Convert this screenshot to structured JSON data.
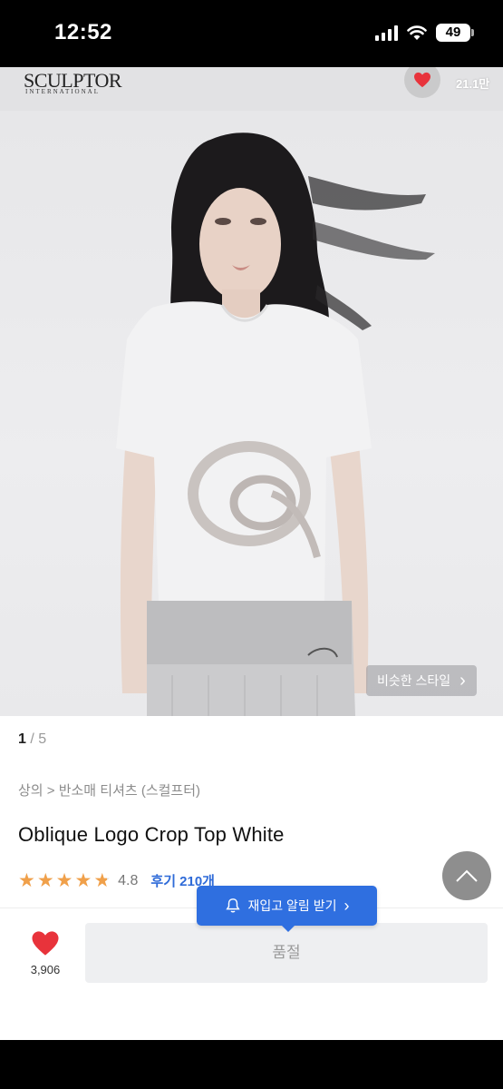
{
  "status_bar": {
    "time": "12:52",
    "battery": "49"
  },
  "header": {
    "brand": "SCULPTOR",
    "brand_sub": "INTERNATIONAL",
    "like_count": "21.1만"
  },
  "hero": {
    "similar_style_label": "비슷한 스타일",
    "similar_arrow": "›"
  },
  "pager": {
    "current": "1",
    "separator": " / ",
    "total": "5"
  },
  "product": {
    "breadcrumb": "상의 > 반소매 티셔츠 (스컬프터)",
    "title": "Oblique Logo Crop Top White",
    "rating": "4.8",
    "rating_stars": 4.8,
    "reviews": "후기 210개"
  },
  "restock_tooltip": {
    "label": "재입고 알림 받기",
    "arrow": "›"
  },
  "bottom_bar": {
    "like_count": "3,906",
    "soldout_label": "품절"
  },
  "colors": {
    "accent": "#2f6fe0",
    "star": "#f0a04a",
    "heart": "#e8333b"
  },
  "icons": [
    "heart-icon",
    "chevron-right-icon",
    "star-icon",
    "chevron-up-icon",
    "bell-icon",
    "signal-icon",
    "wifi-icon",
    "battery-icon"
  ]
}
